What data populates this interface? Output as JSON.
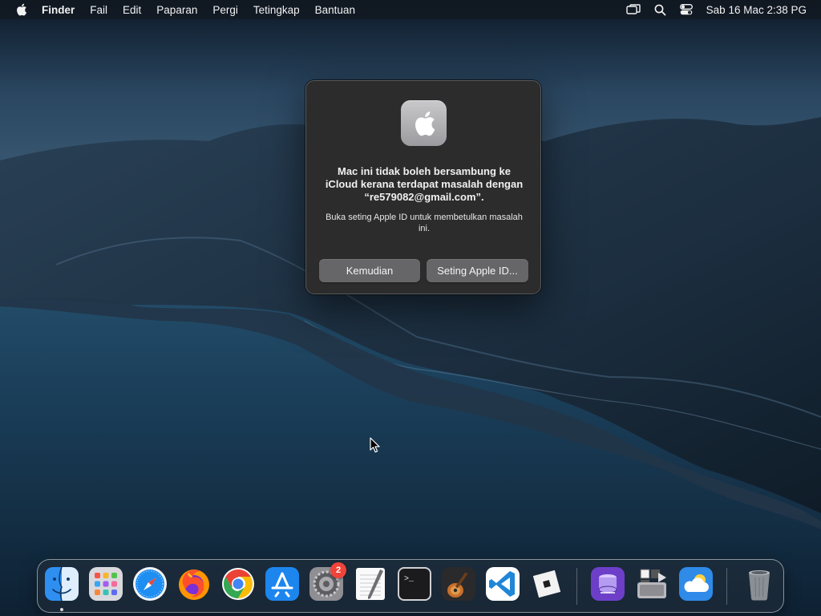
{
  "menubar": {
    "app_name": "Finder",
    "items": [
      "Fail",
      "Edit",
      "Paparan",
      "Pergi",
      "Tetingkap",
      "Bantuan"
    ],
    "clock": "Sab 16 Mac  2:38 PG",
    "status_icons": [
      "screen-mirroring-icon",
      "spotlight-search-icon",
      "control-center-icon"
    ]
  },
  "dialog": {
    "title": "Mac ini tidak boleh bersambung ke iCloud kerana terdapat masalah dengan “re579082@gmail.com”.",
    "message": "Buka seting Apple ID untuk membetulkan masalah ini.",
    "buttons": {
      "later": "Kemudian",
      "settings": "Seting Apple ID..."
    }
  },
  "dock": {
    "apps": [
      "finder-icon",
      "launchpad-icon",
      "safari-icon",
      "firefox-icon",
      "chrome-icon",
      "app-store-icon",
      "system-preferences-icon",
      "textedit-icon",
      "terminal-icon",
      "garageband-icon",
      "vscode-icon",
      "roblox-icon",
      "disk-utility-icon",
      "boot-camp-assistant-icon",
      "icloud-icon",
      "trash-icon"
    ],
    "system_preferences_badge": "2"
  }
}
